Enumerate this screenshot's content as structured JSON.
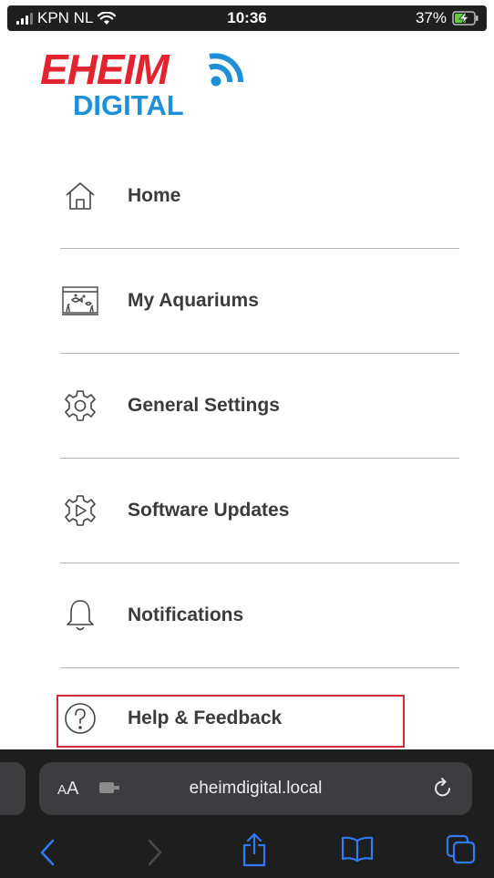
{
  "status_bar": {
    "carrier": "KPN NL",
    "time": "10:36",
    "battery": "37%"
  },
  "logo": {
    "brand": "EHEIM",
    "sub": "DIGITAL"
  },
  "menu": {
    "items": [
      {
        "label": "Home",
        "icon": "home-icon"
      },
      {
        "label": "My Aquariums",
        "icon": "aquarium-icon"
      },
      {
        "label": "General Settings",
        "icon": "gear-icon"
      },
      {
        "label": "Software Updates",
        "icon": "gear-play-icon"
      },
      {
        "label": "Notifications",
        "icon": "bell-icon"
      },
      {
        "label": "Help & Feedback",
        "icon": "help-icon"
      }
    ]
  },
  "browser": {
    "text_size_label": "AA",
    "url": "eheimdigital.local"
  },
  "colors": {
    "brand_red": "#e3232f",
    "brand_blue": "#1f8fd6",
    "highlight": "#d12a3a",
    "safari_bg": "#1e1e1e",
    "safari_accent": "#2f7cf6"
  }
}
